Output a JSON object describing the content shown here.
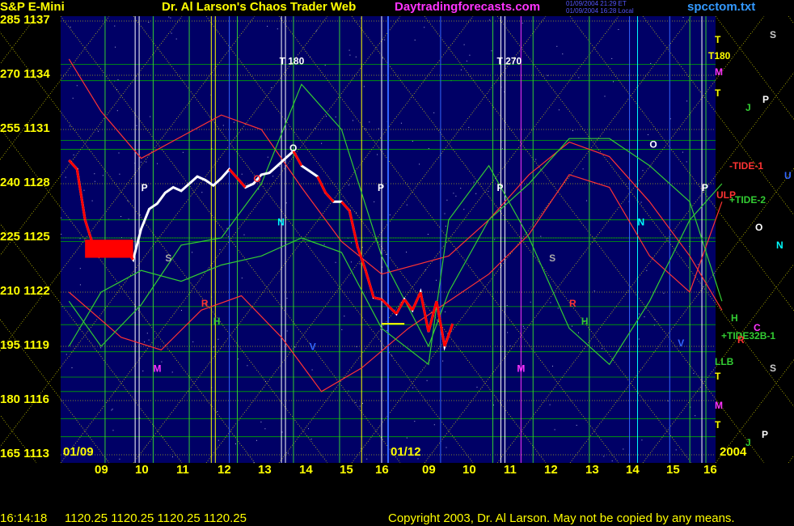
{
  "header": {
    "symbol": "S&P E-Mini",
    "title": "Dr. Al Larson's Chaos Trader Web",
    "url": "Daytradingforecasts.com",
    "file": "spcctom.txt",
    "timestamp1": "01/09/2004 21:29 ET",
    "timestamp2": "01/09/2004 16:28 Local"
  },
  "colors": {
    "plot_bg": "#000066",
    "grid_yellow": "#ffff00",
    "grid_green": "#00aa00",
    "price_white": "#ffffff",
    "price_red": "#ff0000",
    "forecast_red": "#ff3333",
    "forecast_green": "#33cc33",
    "marker_white": "#ffffff",
    "marker_magenta": "#ff33ff",
    "marker_blue": "#3366ff",
    "marker_cyan": "#00ffff"
  },
  "chart_data": {
    "type": "line",
    "y_axis_left_a": [
      "285",
      "270",
      "255",
      "240",
      "225",
      "210",
      "195",
      "180",
      "165"
    ],
    "y_axis_left_b": [
      "1137",
      "1134",
      "1131",
      "1128",
      "1125",
      "1122",
      "1119",
      "1116",
      "1113"
    ],
    "ylim": [
      1113,
      1137
    ],
    "x_ticks": [
      "09",
      "10",
      "11",
      "12",
      "13",
      "14",
      "15",
      "16",
      "09",
      "10",
      "11",
      "12",
      "13",
      "14",
      "15",
      "16"
    ],
    "x_dates": [
      "01/09",
      "01/12"
    ],
    "year": "2004",
    "series": [
      {
        "values": [
          1129.3,
          1128.8,
          1126.0,
          1124.6,
          1124.3,
          1124.6,
          1124.3,
          1124.4,
          1123.8,
          1125.5,
          1126.6,
          1126.9,
          1127.5,
          1127.8,
          1127.6,
          1128.0,
          1128.4,
          1128.2,
          1127.9,
          1128.3,
          1128.8,
          1128.3,
          1127.8,
          1128.0,
          1128.5,
          1128.6,
          1129.0,
          1129.4,
          1129.8,
          1129.0,
          1128.7,
          1128.4,
          1127.5,
          1127.0,
          1127.0,
          1126.5,
          1124.5,
          1123.2,
          1121.7,
          1121.6,
          1120.8,
          1121.6,
          1121.0,
          1122.0,
          1119.8,
          1121.5,
          1119.0,
          1120.25
        ],
        "x": [
          8.2,
          8.4,
          8.6,
          8.8,
          9.0,
          9.2,
          9.4,
          9.6,
          9.8,
          10.0,
          10.2,
          10.4,
          10.6,
          10.8,
          11.0,
          11.2,
          11.4,
          11.6,
          11.8,
          12.0,
          12.2,
          12.4,
          12.6,
          12.8,
          13.0,
          13.2,
          13.4,
          13.6,
          13.8,
          14.0,
          14.2,
          14.4,
          14.6,
          14.8,
          15.0,
          15.2,
          15.4,
          15.6,
          15.8,
          16.0,
          16.2,
          16.4,
          16.6,
          16.8,
          17.0,
          17.2,
          17.4,
          17.6
        ]
      }
    ],
    "forecast_labels_left": [
      "P",
      "S",
      "R",
      "H",
      "M",
      "T 180",
      "O",
      "N",
      "V",
      "P",
      "O"
    ],
    "forecast_labels_mid": [
      "T 270",
      "P",
      "S",
      "R",
      "H",
      "M",
      "O",
      "N",
      "V",
      "P"
    ],
    "right_labels": [
      {
        "text": "T",
        "color": "#ffff00"
      },
      {
        "text": "T180",
        "color": "#ffff00"
      },
      {
        "text": "M",
        "color": "#ff33ff"
      },
      {
        "text": "T",
        "color": "#ffff00"
      },
      {
        "text": "-TIDE-1",
        "color": "#ff3333"
      },
      {
        "text": "ULP",
        "color": "#ff3333"
      },
      {
        "text": "+TIDE-2",
        "color": "#33cc33"
      },
      {
        "text": "H",
        "color": "#33cc33"
      },
      {
        "text": "+TIDE32B-1",
        "color": "#33cc33"
      },
      {
        "text": "C",
        "color": "#ff33ff"
      },
      {
        "text": "R",
        "color": "#ff3333"
      },
      {
        "text": "LLB",
        "color": "#33cc33"
      },
      {
        "text": "T",
        "color": "#ffff00"
      },
      {
        "text": "M",
        "color": "#ff33ff"
      },
      {
        "text": "T",
        "color": "#ffff00"
      },
      {
        "text": "J",
        "color": "#33cc33"
      }
    ],
    "far_right_labels": [
      {
        "text": "S",
        "color": "#cccccc"
      },
      {
        "text": "P",
        "color": "#ffffff"
      },
      {
        "text": "J",
        "color": "#33cc33"
      },
      {
        "text": "U",
        "color": "#3366ff"
      },
      {
        "text": "O",
        "color": "#ffffff"
      },
      {
        "text": "N",
        "color": "#00ffff"
      },
      {
        "text": "S",
        "color": "#cccccc"
      },
      {
        "text": "P",
        "color": "#ffffff"
      }
    ]
  },
  "footer": {
    "time": "16:14:18",
    "prices": "1120.25 1120.25 1120.25 1120.25",
    "copyright": "Copyright 2003, Dr. Al Larson. May not be copied by any means."
  }
}
